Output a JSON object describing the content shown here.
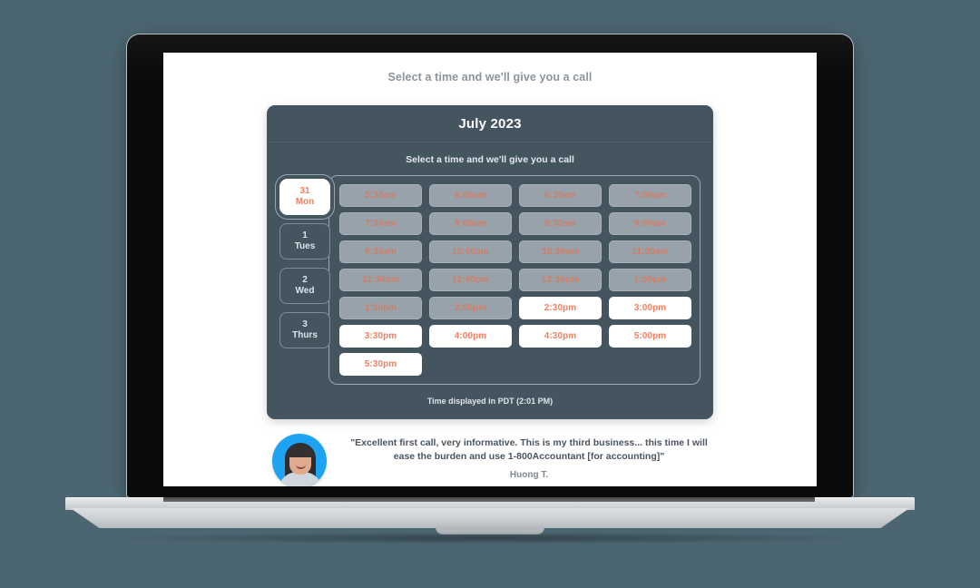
{
  "page": {
    "heading": "Select a time and we'll give you a call"
  },
  "scheduler": {
    "month_title": "July 2023",
    "subheading": "Select a time and we'll give you a call",
    "timezone_note": "Time displayed in PDT (2:01 PM)",
    "days": [
      {
        "num": "31",
        "name": "Mon",
        "selected": true
      },
      {
        "num": "1",
        "name": "Tues",
        "selected": false
      },
      {
        "num": "2",
        "name": "Wed",
        "selected": false
      },
      {
        "num": "3",
        "name": "Thurs",
        "selected": false
      }
    ],
    "slots": [
      {
        "label": "5:30am",
        "state": "disabled"
      },
      {
        "label": "6:00am",
        "state": "disabled"
      },
      {
        "label": "6:30am",
        "state": "disabled"
      },
      {
        "label": "7:00am",
        "state": "disabled"
      },
      {
        "label": "7:30am",
        "state": "disabled"
      },
      {
        "label": "8:00am",
        "state": "disabled"
      },
      {
        "label": "8:30am",
        "state": "disabled"
      },
      {
        "label": "9:00am",
        "state": "disabled"
      },
      {
        "label": "9:30am",
        "state": "disabled"
      },
      {
        "label": "10:00am",
        "state": "disabled"
      },
      {
        "label": "10:30am",
        "state": "disabled"
      },
      {
        "label": "11:00am",
        "state": "disabled"
      },
      {
        "label": "11:30am",
        "state": "disabled"
      },
      {
        "label": "12:00pm",
        "state": "disabled"
      },
      {
        "label": "12:30pm",
        "state": "disabled"
      },
      {
        "label": "1:00pm",
        "state": "disabled"
      },
      {
        "label": "1:30pm",
        "state": "disabled"
      },
      {
        "label": "2:00pm",
        "state": "disabled"
      },
      {
        "label": "2:30pm",
        "state": "available"
      },
      {
        "label": "3:00pm",
        "state": "available"
      },
      {
        "label": "3:30pm",
        "state": "available"
      },
      {
        "label": "4:00pm",
        "state": "available"
      },
      {
        "label": "4:30pm",
        "state": "available"
      },
      {
        "label": "5:00pm",
        "state": "available"
      },
      {
        "label": "5:30pm",
        "state": "available"
      }
    ]
  },
  "testimonial": {
    "quote": "\"Excellent first call, very informative. This is my third business... this time I will ease the burden and use 1-800Accountant [for accounting]\"",
    "author": "Huong T.",
    "avatar_background": "#1ea3f2"
  },
  "colors": {
    "page_background": "#4c6671",
    "card_background": "#45555f",
    "accent_orange": "#f28060",
    "disabled_slot": "#98a2ab"
  }
}
